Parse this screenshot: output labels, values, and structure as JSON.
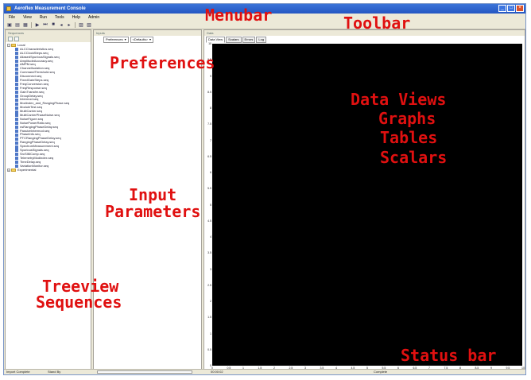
{
  "window": {
    "title": "Aeroflex Measurement Console",
    "buttons": [
      "_",
      "□",
      "×"
    ]
  },
  "menubar": {
    "items": [
      "File",
      "View",
      "Run",
      "Tools",
      "Help",
      "Admin"
    ]
  },
  "toolbar": {
    "icons": [
      "open-icon",
      "save-icon",
      "save-all-icon",
      "run-icon",
      "step-icon",
      "stop-icon",
      "back-icon",
      "forward-icon",
      "chart-icon",
      "options-icon"
    ]
  },
  "left_panel": {
    "header": "Sequences",
    "tree": {
      "root_local": "Local",
      "items": [
        "ALCCharacteristics.seq",
        "ALCClockSteps.seq",
        "AliasedSpuriousSignals.seq",
        "AmplitudeAccuracy.seq",
        "AMPM.seq",
        "ChannelIsolation.seq",
        "CommandThreshold.seq",
        "Disconnect.seq",
        "FixedGainSteps.seq",
        "FreqConversion.seq",
        "FreqResponse.seq",
        "GainTransfer.seq",
        "GroupDelay.seq",
        "Intermod.seq",
        "Modindex_and_RangingPhase.seq",
        "ModuleTest.seq",
        "MultiCarrier.seq",
        "MultiCarrierPhaseNoise.seq",
        "NoiseFigure.seq",
        "NoisePowerRatio.seq",
        "nsRangingPhaseDelay.seq",
        "PassiveIntermod.seq",
        "PhaseInfo.seq",
        "PTCRangingPhaseDelay.seq",
        "RangingPhaseDelay.seq",
        "SpectrumMeasurement.seq",
        "SpuriousSignals.seq",
        "SrcSIMComp.seq",
        "TelemetryModindex.seq",
        "TimeDelay.seq",
        "VariationMonitor.seq"
      ],
      "root_experimental": "Experimental"
    }
  },
  "mid_panel": {
    "header": "Inputs",
    "preferences_label": "Preferences",
    "preferences_value": "<Defaults>"
  },
  "right_panel": {
    "header": "Data",
    "tabs": [
      "Data View",
      "Scalars",
      "Errors",
      "Log"
    ],
    "y_ticks": [
      "10",
      "9.5",
      "9",
      "8.5",
      "8",
      "7.5",
      "7",
      "6.5",
      "6",
      "5.5",
      "5",
      "4.5",
      "4",
      "3.5",
      "3",
      "2.5",
      "2",
      "1.5",
      "1",
      "0.5",
      "0"
    ],
    "x_ticks": [
      "0",
      "0.5",
      "1",
      "1.5",
      "2",
      "2.5",
      "3",
      "3.5",
      "4",
      "4.5",
      "5",
      "5.5",
      "6",
      "6.5",
      "7",
      "7.5",
      "8",
      "8.5",
      "9",
      "9.5",
      "10"
    ]
  },
  "statusbar": {
    "left": "Import Complete",
    "ready": "Stand By",
    "time": "00:00:02",
    "status": "Complete"
  },
  "annotations": {
    "menubar": "Menubar",
    "toolbar": "Toolbar",
    "preferences": "Preferences",
    "data_views": "Data Views",
    "graphs": "Graphs",
    "tables": "Tables",
    "scalars": "Scalars",
    "input1": "Input",
    "input2": "Parameters",
    "treeview1": "Treeview",
    "treeview2": "Sequences",
    "statusbar": "Status bar"
  },
  "colors": {
    "annotation": "#e01010",
    "titlebar": "#2a5ccc",
    "plot_background": "#000000"
  }
}
